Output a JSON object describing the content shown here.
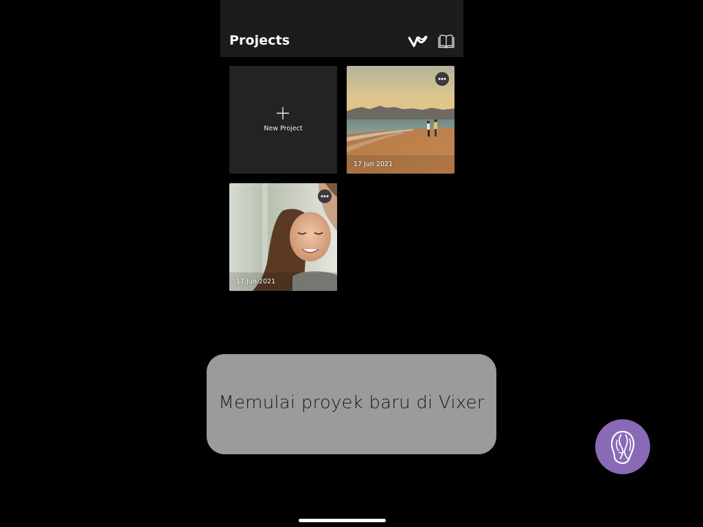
{
  "header": {
    "title": "Projects",
    "icons": [
      "vixer-logo-icon",
      "book-icon"
    ]
  },
  "projects": {
    "new_project_label": "New Project",
    "items": [
      {
        "date": "17 Jun 2021",
        "thumbnail": "beach-sunset"
      },
      {
        "date": "17 Jun 2021",
        "thumbnail": "portrait-smiling-woman"
      }
    ]
  },
  "caption": {
    "text": "Memulai proyek baru di Vixer"
  },
  "colors": {
    "background": "#000000",
    "header_bg": "#1c1c1e",
    "tile_bg": "#232325",
    "caption_bg": "#9b9b9b",
    "brand_purple": "#8a6ab7"
  }
}
